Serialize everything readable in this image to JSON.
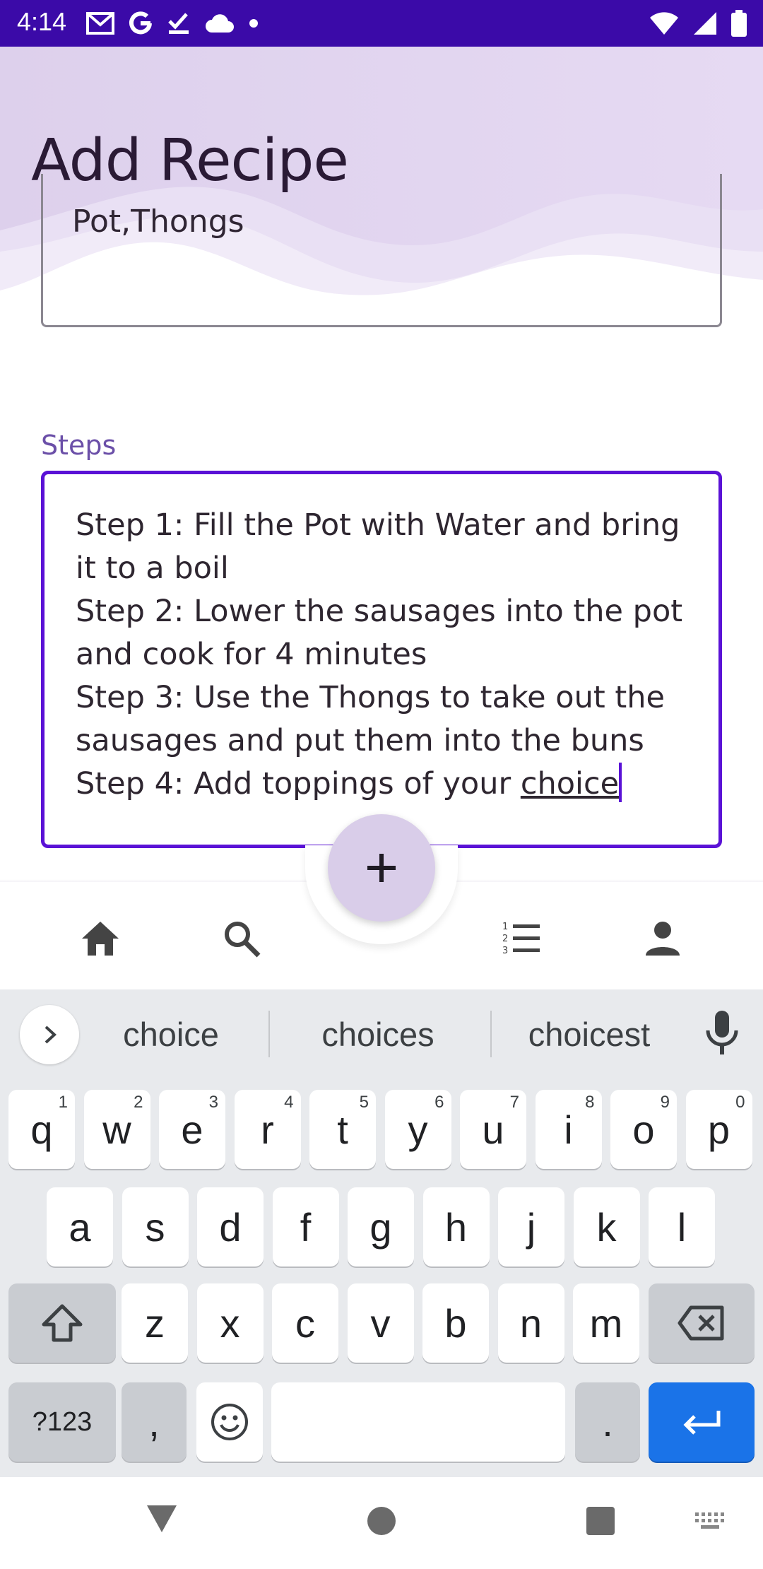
{
  "status_bar": {
    "time": "4:14",
    "left_icons": [
      "gmail-icon",
      "google-icon",
      "task-check-icon",
      "cloud-icon",
      "dot-icon"
    ],
    "right_icons": [
      "wifi-icon",
      "signal-icon",
      "battery-icon"
    ]
  },
  "header": {
    "title": "Add Recipe"
  },
  "ingredients": {
    "value": "Pot,Thongs"
  },
  "steps": {
    "label": "Steps",
    "value": "Step 1: Fill the Pot with Water and bring it to a boil\nStep 2: Lower the sausages into the pot and cook for 4 minutes\nStep 3: Use the Thongs to take out the sausages and put them into the buns\nStep 4: Add toppings of your ",
    "underlined_word": "choice"
  },
  "fab": {
    "icon": "plus-icon",
    "label": "+"
  },
  "bottom_nav": {
    "items": [
      "home-icon",
      "search-icon",
      "list-icon",
      "person-icon"
    ]
  },
  "keyboard": {
    "suggestions": [
      "choice",
      "choices",
      "choicest"
    ],
    "row1": [
      [
        "q",
        "1"
      ],
      [
        "w",
        "2"
      ],
      [
        "e",
        "3"
      ],
      [
        "r",
        "4"
      ],
      [
        "t",
        "5"
      ],
      [
        "y",
        "6"
      ],
      [
        "u",
        "7"
      ],
      [
        "i",
        "8"
      ],
      [
        "o",
        "9"
      ],
      [
        "p",
        "0"
      ]
    ],
    "row2": [
      "a",
      "s",
      "d",
      "f",
      "g",
      "h",
      "j",
      "k",
      "l"
    ],
    "row3": [
      "z",
      "x",
      "c",
      "v",
      "b",
      "n",
      "m"
    ],
    "symbols_label": "?123",
    "comma_label": ",",
    "period_label": ".",
    "colors": {
      "enter": "#1a73e8",
      "background": "#e8eaed",
      "accent": "#5a12d6"
    }
  }
}
